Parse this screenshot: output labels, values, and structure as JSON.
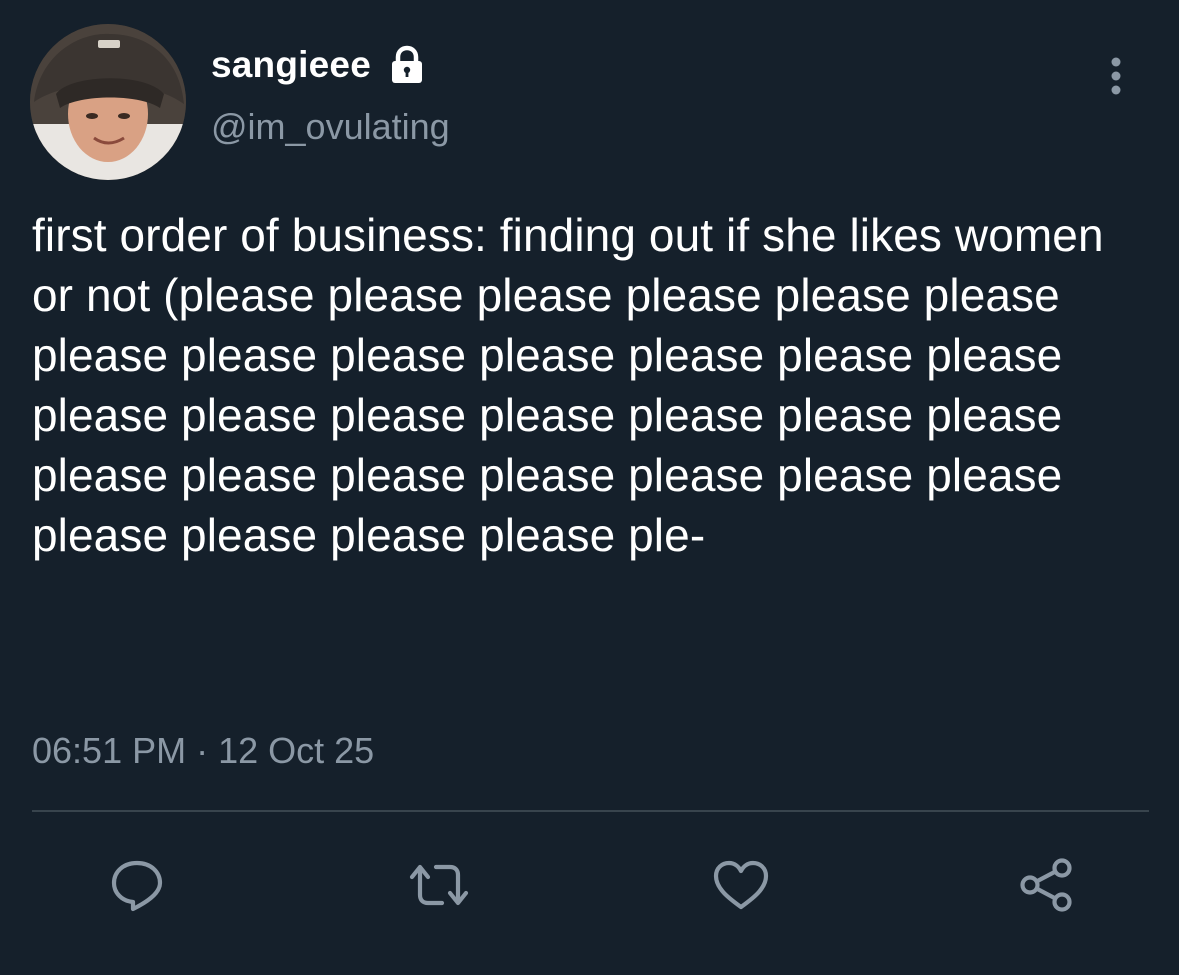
{
  "author": {
    "display_name": "sangieee",
    "handle": "@im_ovulating",
    "protected_icon": "lock-icon",
    "avatar_icon": "profile-avatar"
  },
  "tweet": {
    "text": "first order of business: finding out if she likes women or not (please please please please please please please please please please please please please please please please please please please please please please please please please please please please please please please ple-",
    "time": "06:51 PM",
    "separator": "·",
    "date": "12 Oct 25"
  },
  "actions": [
    {
      "name": "reply",
      "icon": "reply-icon"
    },
    {
      "name": "retweet",
      "icon": "retweet-icon"
    },
    {
      "name": "like",
      "icon": "heart-icon"
    },
    {
      "name": "share",
      "icon": "share-icon"
    }
  ],
  "colors": {
    "background": "#15202b",
    "primary_text": "#ffffff",
    "secondary_text": "#8b98a5",
    "divider": "#38444d"
  }
}
